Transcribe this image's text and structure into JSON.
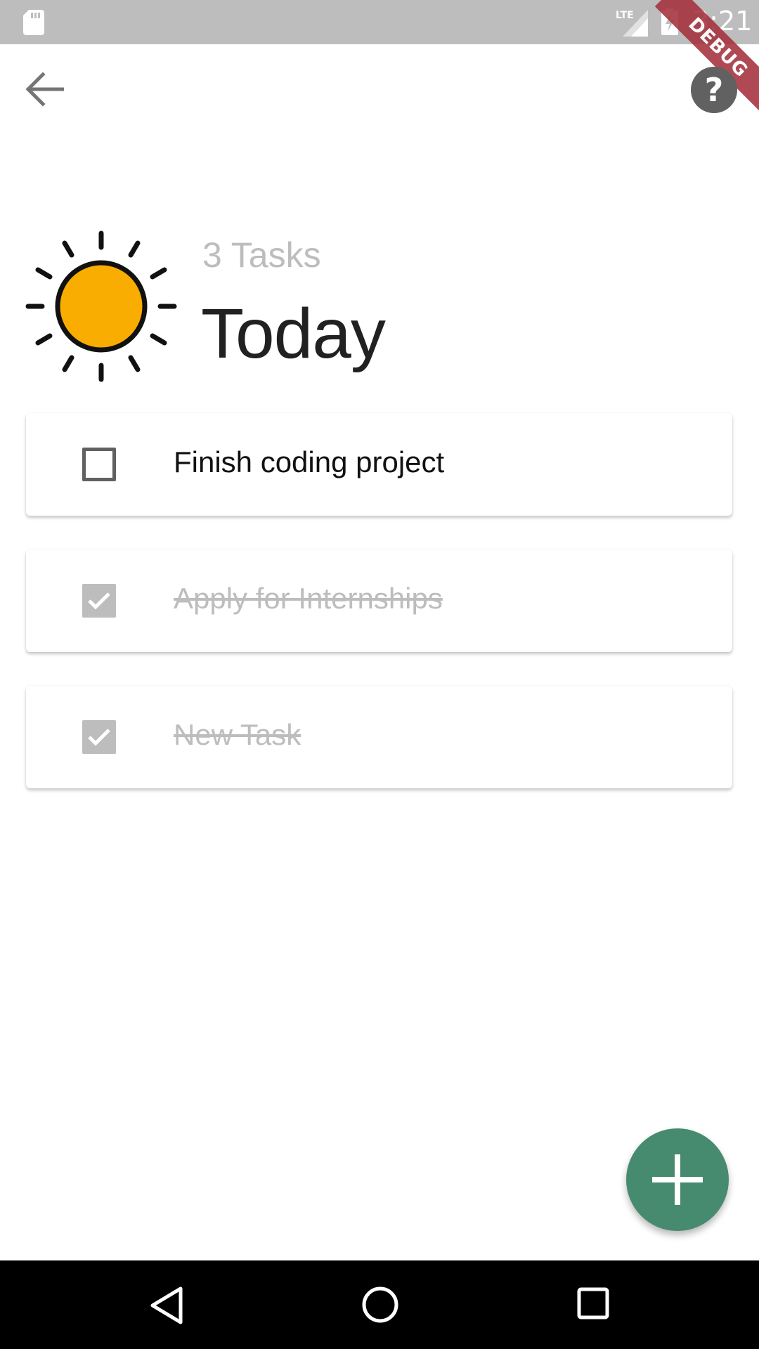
{
  "status_bar": {
    "network": "LTE",
    "time": "3:21"
  },
  "debug_banner": "DEBUG",
  "app_bar": {
    "back_icon": "arrow-back-icon",
    "help_icon": "help-circle-icon"
  },
  "header": {
    "icon": "sun-icon",
    "task_count": "3 Tasks",
    "title": "Today"
  },
  "tasks": [
    {
      "label": "Finish coding project",
      "completed": false
    },
    {
      "label": "Apply for Internships",
      "completed": true
    },
    {
      "label": "New Task",
      "completed": true
    }
  ],
  "fab": {
    "icon": "plus-icon"
  },
  "colors": {
    "sun_fill": "#F9AD00",
    "fab": "#468A6F",
    "status_bar": "#BDBDBD",
    "debug_ribbon": "#A5303D",
    "completed_text": "#BDBDBD"
  },
  "nav_bar": {
    "back_icon": "nav-back-triangle-icon",
    "home_icon": "nav-home-circle-icon",
    "recents_icon": "nav-recents-square-icon"
  }
}
